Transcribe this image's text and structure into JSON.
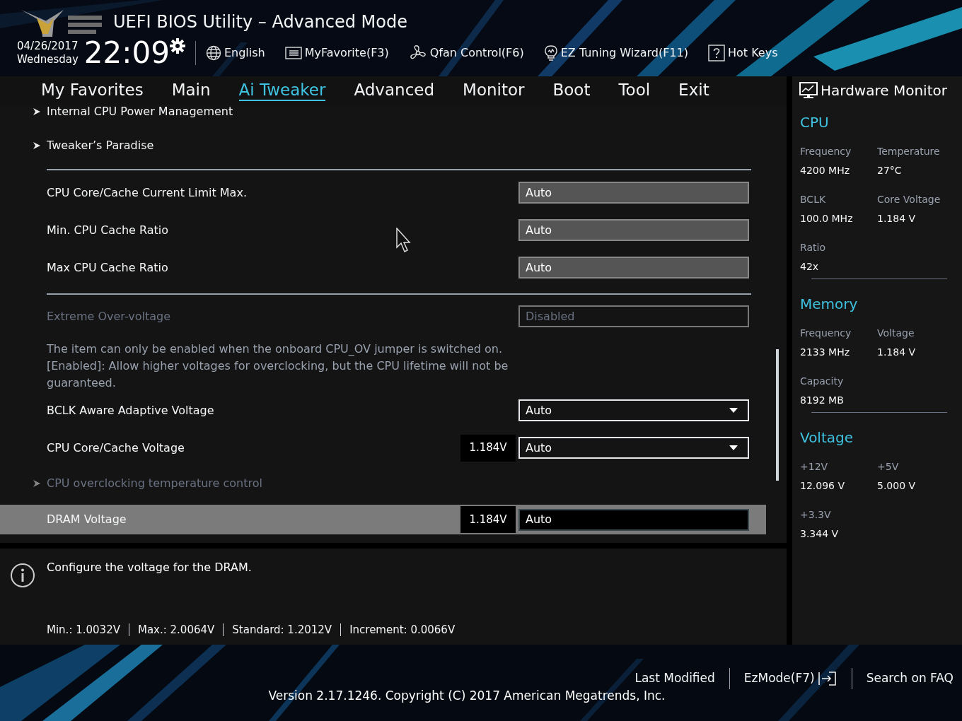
{
  "header": {
    "title": "UEFI BIOS Utility – Advanced Mode",
    "date": "04/26/2017",
    "day": "Wednesday",
    "time": "22:09",
    "tools": [
      {
        "label": "English"
      },
      {
        "label": "MyFavorite(F3)"
      },
      {
        "label": "Qfan Control(F6)"
      },
      {
        "label": "EZ Tuning Wizard(F11)"
      },
      {
        "label": "Hot Keys"
      }
    ]
  },
  "tabs": [
    {
      "label": "My Favorites",
      "selected": false
    },
    {
      "label": "Main",
      "selected": false
    },
    {
      "label": "Ai Tweaker",
      "selected": true
    },
    {
      "label": "Advanced",
      "selected": false
    },
    {
      "label": "Monitor",
      "selected": false
    },
    {
      "label": "Boot",
      "selected": false
    },
    {
      "label": "Tool",
      "selected": false
    },
    {
      "label": "Exit",
      "selected": false
    }
  ],
  "items": [
    {
      "kind": "submenu",
      "label": "Internal CPU Power Management",
      "disabled": false,
      "selected": false
    },
    {
      "kind": "submenu",
      "label": "Tweaker’s Paradise",
      "disabled": false,
      "selected": false
    },
    {
      "kind": "divider"
    },
    {
      "kind": "field",
      "label": "CPU Core/Cache Current Limit Max.",
      "value": "Auto",
      "disabled": false,
      "selected": false
    },
    {
      "kind": "field",
      "label": "Min. CPU Cache Ratio",
      "value": "Auto",
      "disabled": false,
      "selected": false
    },
    {
      "kind": "field",
      "label": "Max CPU Cache Ratio",
      "value": "Auto",
      "disabled": false,
      "selected": false
    },
    {
      "kind": "divider"
    },
    {
      "kind": "field",
      "label": "Extreme Over-voltage",
      "value": "Disabled",
      "disabled": true,
      "selected": false
    },
    {
      "kind": "note",
      "lines": [
        "The item can only be enabled when the onboard CPU_OV jumper is switched on.",
        "[Enabled]: Allow higher voltages for overclocking, but the CPU lifetime will not be guaranteed."
      ]
    },
    {
      "kind": "dropdown",
      "label": "BCLK Aware Adaptive Voltage",
      "value": "Auto",
      "disabled": false,
      "selected": false
    },
    {
      "kind": "dropdown",
      "label": "CPU Core/Cache Voltage",
      "reading": "1.184V",
      "value": "Auto",
      "disabled": false,
      "selected": false
    },
    {
      "kind": "submenu",
      "label": "CPU overclocking temperature control",
      "disabled": true,
      "selected": false
    },
    {
      "kind": "field",
      "label": "DRAM Voltage",
      "reading": "1.184V",
      "value": "Auto",
      "disabled": false,
      "selected": true
    }
  ],
  "help": {
    "text": "Configure the voltage for the DRAM.",
    "specs": [
      "Min.: 1.0032V",
      "Max.: 2.0064V",
      "Standard: 1.2012V",
      "Increment: 0.0066V"
    ]
  },
  "monitor": {
    "title": "Hardware Monitor",
    "sections": [
      {
        "title": "CPU",
        "stats": [
          {
            "label": "Frequency",
            "value": "4200 MHz"
          },
          {
            "label": "Temperature",
            "value": "27°C"
          },
          {
            "label": "BCLK",
            "value": "100.0 MHz"
          },
          {
            "label": "Core Voltage",
            "value": "1.184 V"
          },
          {
            "label": "Ratio",
            "value": "42x"
          }
        ]
      },
      {
        "title": "Memory",
        "stats": [
          {
            "label": "Frequency",
            "value": "2133 MHz"
          },
          {
            "label": "Voltage",
            "value": "1.184 V"
          },
          {
            "label": "Capacity",
            "value": "8192 MB"
          }
        ]
      },
      {
        "title": "Voltage",
        "stats": [
          {
            "label": "+12V",
            "value": "12.096 V"
          },
          {
            "label": "+5V",
            "value": "5.000 V"
          },
          {
            "label": "+3.3V",
            "value": "3.344 V"
          }
        ]
      }
    ]
  },
  "footer": {
    "links": [
      "Last Modified",
      "EzMode(F7)",
      "Search on FAQ"
    ],
    "version": "Version 2.17.1246. Copyright (C) 2017 American Megatrends, Inc."
  }
}
